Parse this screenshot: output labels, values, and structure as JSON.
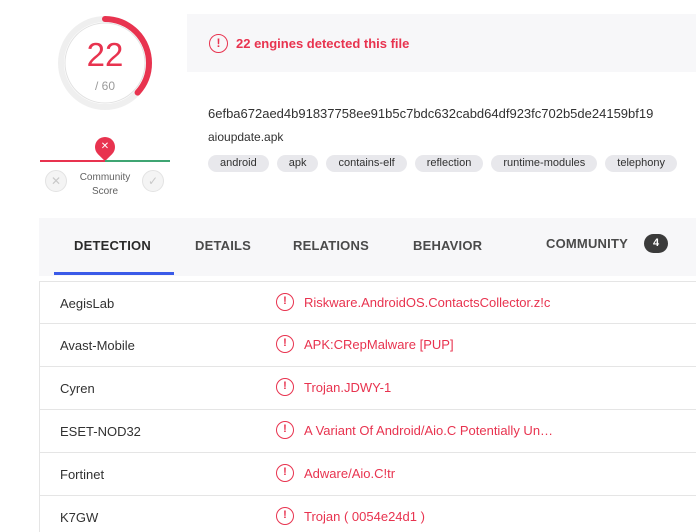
{
  "score": {
    "positives": "22",
    "total": "/ 60",
    "fraction": 0.3667,
    "ring_color": "#e8334f",
    "community_label_line1": "Community",
    "community_label_line2": "Score",
    "vote_down_icon": "x-icon",
    "vote_up_icon": "check-icon",
    "marker_icon": "x-icon"
  },
  "banner": {
    "text": "22 engines detected this file",
    "icon": "alert-circle-icon"
  },
  "file": {
    "hash": "6efba672aed4b91837758ee91b5c7bdc632cabd64df923fc702b5de24159bf19",
    "name": "aioupdate.apk",
    "tags": [
      "android",
      "apk",
      "contains-elf",
      "reflection",
      "runtime-modules",
      "telephony"
    ]
  },
  "tabs": {
    "detection": "DETECTION",
    "details": "DETAILS",
    "relations": "RELATIONS",
    "behavior": "BEHAVIOR",
    "community": "COMMUNITY",
    "community_count": "4"
  },
  "results": [
    {
      "engine": "AegisLab",
      "verdict": "Riskware.AndroidOS.ContactsCollector.z!c"
    },
    {
      "engine": "Avast-Mobile",
      "verdict": "APK:CRepMalware [PUP]"
    },
    {
      "engine": "Cyren",
      "verdict": "Trojan.JDWY-1"
    },
    {
      "engine": "ESET-NOD32",
      "verdict": "A Variant Of Android/Aio.C Potentially Un…"
    },
    {
      "engine": "Fortinet",
      "verdict": "Adware/Aio.C!tr"
    },
    {
      "engine": "K7GW",
      "verdict": "Trojan ( 0054e24d1 )"
    }
  ],
  "colors": {
    "accent": "#e8334f",
    "tab_indicator": "#3a5ae8",
    "harmless": "#3fa573"
  }
}
